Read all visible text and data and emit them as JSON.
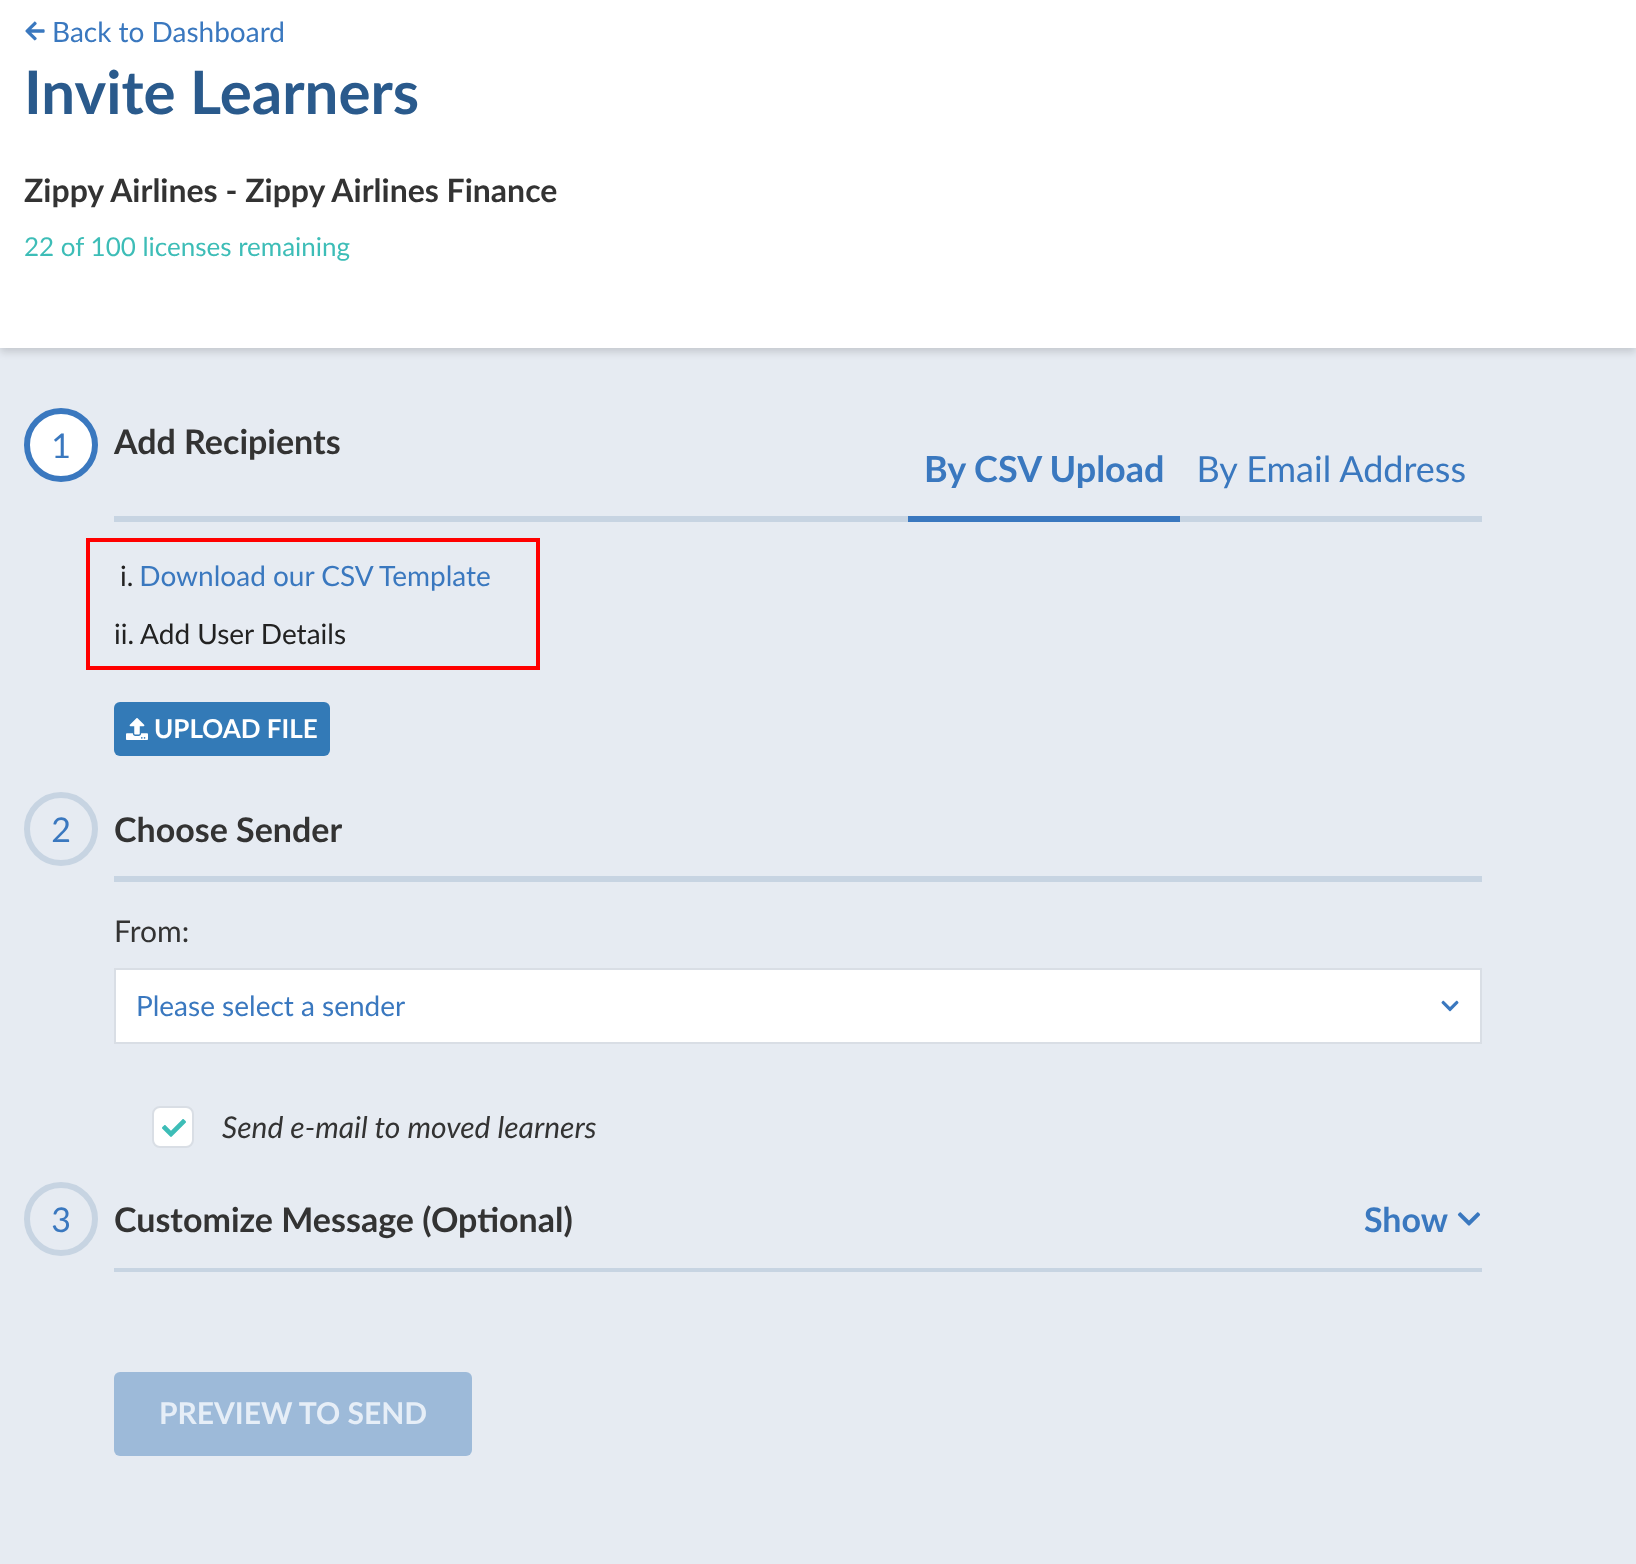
{
  "header": {
    "back_link": "Back to Dashboard",
    "title": "Invite Learners",
    "organization": "Zippy Airlines - Zippy Airlines Finance",
    "licenses": "22 of 100 licenses remaining"
  },
  "steps": [
    {
      "number": "1",
      "title": "Add Recipients",
      "active": true,
      "kind": "recipients"
    },
    {
      "number": "2",
      "title": "Choose Sender",
      "active": false,
      "kind": "sender"
    },
    {
      "number": "3",
      "title": "Customize Message (Optional)",
      "active": false,
      "kind": "message"
    }
  ],
  "recipients": {
    "tabs": [
      {
        "label": "By CSV Upload",
        "selected": true
      },
      {
        "label": "By Email Address",
        "selected": false
      }
    ],
    "instructions": {
      "highlighted": true,
      "items": [
        {
          "marker": "i.",
          "text": "Download our CSV Template",
          "kind": "link"
        },
        {
          "marker": "ii.",
          "text": "Add User Details",
          "kind": "text"
        }
      ]
    },
    "upload_button": "UPLOAD FILE"
  },
  "sender": {
    "label": "From:",
    "select_value": "Please select a sender",
    "checkbox": {
      "label": "Send e-mail to moved learners",
      "checked": true
    }
  },
  "message": {
    "toggle": "Show",
    "expanded": false
  },
  "preview_button": {
    "label": "PREVIEW TO SEND",
    "disabled": true
  }
}
